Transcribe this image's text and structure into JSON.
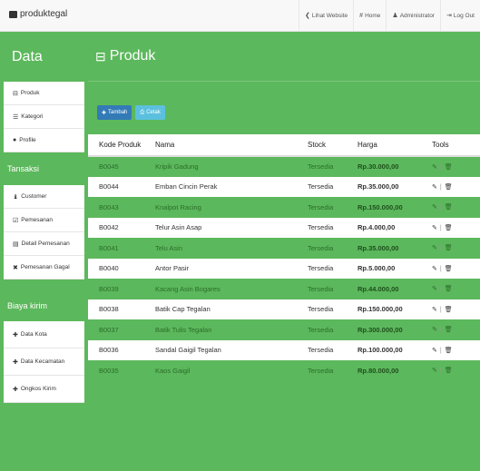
{
  "topbar": {
    "brand": "produktegal",
    "nav": [
      {
        "icon": "chevron-left-icon",
        "glyph": "❮",
        "label": "Lihat Website"
      },
      {
        "icon": "home-icon",
        "glyph": "#",
        "label": "Home"
      },
      {
        "icon": "user-icon",
        "glyph": "♟",
        "label": "Administrator"
      },
      {
        "icon": "logout-icon",
        "glyph": "⇥",
        "label": "Log Out"
      }
    ]
  },
  "sidebar": {
    "title": "Data",
    "data_items": [
      {
        "glyph": "⊟",
        "label": "Produk"
      },
      {
        "glyph": "☰",
        "label": "Kategori"
      },
      {
        "glyph": "●",
        "label": "Profile"
      }
    ],
    "transaksi_title": "Tansaksi",
    "transaksi_items": [
      {
        "glyph": "♝",
        "label": "Customer"
      },
      {
        "glyph": "☑",
        "label": "Pemesanan"
      },
      {
        "glyph": "▤",
        "label": "Detail Pemesanan"
      },
      {
        "glyph": "✖",
        "label": "Pemesanan Gagal"
      }
    ],
    "biaya_title": "Biaya kirim",
    "biaya_items": [
      {
        "glyph": "✚",
        "label": "Data Kota"
      },
      {
        "glyph": "✚",
        "label": "Data Kecamatan"
      },
      {
        "glyph": "✚",
        "label": "Ongkos Kirim"
      }
    ]
  },
  "main": {
    "title": "Produk",
    "title_glyph": "⊟",
    "buttons": {
      "tambah": "Tambah",
      "cetak": "Cetak"
    },
    "table": {
      "headers": [
        "Kode Produk",
        "Nama",
        "Stock",
        "Harga",
        "Tools"
      ],
      "rows": [
        [
          "B0045",
          "Kripik Gadung",
          "Tersedia",
          "Rp.30.000,00"
        ],
        [
          "B0044",
          "Emban Cincin Perak",
          "Tersedia",
          "Rp.35.000,00"
        ],
        [
          "B0043",
          "Knalpot Racing",
          "Tersedia",
          "Rp.150.000,00"
        ],
        [
          "B0042",
          "Telur Asin Asap",
          "Tersedia",
          "Rp.4.000,00"
        ],
        [
          "B0041",
          "Telu Asin",
          "Tersedia",
          "Rp.35.000,00"
        ],
        [
          "B0040",
          "Antor Pasir",
          "Tersedia",
          "Rp.5.000,00"
        ],
        [
          "B0039",
          "Kacang Asin Bogares",
          "Tersedia",
          "Rp.44.000,00"
        ],
        [
          "B0038",
          "Batik Cap Tegalan",
          "Tersedia",
          "Rp.150.000,00"
        ],
        [
          "B0037",
          "Batik Tulis Tegalan",
          "Tersedia",
          "Rp.300.000,00"
        ],
        [
          "B0036",
          "Sandal Gaigil Tegalan",
          "Tersedia",
          "Rp.100.000,00"
        ],
        [
          "B0035",
          "Kaos Gaigil",
          "Tersedia",
          "Rp.80.000,00"
        ]
      ],
      "tools": {
        "edit_glyph": "✎",
        "delete_glyph": "🗑",
        "separator": "|"
      }
    }
  },
  "colors": {
    "green": "#5cb85c",
    "blue": "#337ab7",
    "info": "#5bc0de"
  }
}
